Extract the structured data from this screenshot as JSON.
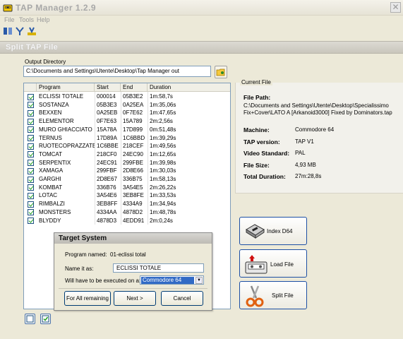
{
  "window": {
    "title": "TAP Manager 1.2.9",
    "close_glyph": "✕"
  },
  "menu": [
    "File",
    "Tools",
    "Help"
  ],
  "toolbar_icons": [
    "split-icon",
    "merge-icon",
    "convert-icon"
  ],
  "section": {
    "title": "Split TAP File"
  },
  "output": {
    "label": "Output Directory",
    "value": "C:\\Documents and Settings\\Utente\\Desktop\\Tap Manager out"
  },
  "list": {
    "columns": [
      "Program",
      "Start",
      "End",
      "Duration"
    ],
    "rows": [
      [
        "ECLISSI TOTALE",
        "000014",
        "05B3E2",
        "1m:58,7s"
      ],
      [
        "SOSTANZA",
        "05B3E3",
        "0A25EA",
        "1m:35,06s"
      ],
      [
        "BEXXEN",
        "0A25EB",
        "0F7E62",
        "1m:47,65s"
      ],
      [
        "ELEMENTOR",
        "0F7E63",
        "15A789",
        "2m:2,56s"
      ],
      [
        "MURO GHIACCIATO",
        "15A78A",
        "17D899",
        "0m:51,48s"
      ],
      [
        "TERNUS",
        "17D89A",
        "1C6BBD",
        "1m:39,29s"
      ],
      [
        "RUOTECOPRAZZATE",
        "1C6BBE",
        "218CEF",
        "1m:49,56s"
      ],
      [
        "TOMCAT",
        "218CF0",
        "24EC90",
        "1m:12,65s"
      ],
      [
        "SERPENTIX",
        "24EC91",
        "299FBE",
        "1m:39,98s"
      ],
      [
        "XAMAGA",
        "299FBF",
        "2D8E66",
        "1m:30,03s"
      ],
      [
        "GARGHI",
        "2D8E67",
        "336B75",
        "1m:58,13s"
      ],
      [
        "KOMBAT",
        "336B76",
        "3A54E5",
        "2m:26,22s"
      ],
      [
        "LOTAC",
        "3A54E6",
        "3EB8FE",
        "1m:33,53s"
      ],
      [
        "RIMBALZI",
        "3EB8FF",
        "4334A9",
        "1m:34,94s"
      ],
      [
        "MONSTERS",
        "4334AA",
        "4878D2",
        "1m:48,78s"
      ],
      [
        "BLYDDY",
        "4878D3",
        "4EDD91",
        "2m:0,24s"
      ]
    ]
  },
  "current_file": {
    "legend": "Current File",
    "path_label": "File Path:",
    "path_value": "C:\\Documents and Settings\\Utente\\Desktop\\Specialissimo Fix+Cover\\LATO A [Arkanoid3000] Fixed by Dominators.tap",
    "machine_label": "Machine:",
    "machine_value": "Commodore 64",
    "tap_version_label": "TAP version:",
    "tap_version_value": "TAP V1",
    "video_label": "Video Standard:",
    "video_value": "PAL",
    "size_label": "File Size:",
    "size_value": "4,93 MB",
    "duration_label": "Total Duration:",
    "duration_value": "27m:28,8s"
  },
  "actions": {
    "index": "Index D64",
    "load": "Load File",
    "split": "Split File"
  },
  "dialog": {
    "title": "Target System",
    "program_named_label": "Program named:",
    "program_named_value": "01-eclissi total",
    "name_label": "Name it as:",
    "name_value": "ECLISSI TOTALE",
    "exec_label": "Will have to be executed on a:",
    "exec_value": "Commodore 64",
    "btn_all": "For All remaining",
    "btn_next": "Next >",
    "btn_cancel": "Cancel"
  }
}
